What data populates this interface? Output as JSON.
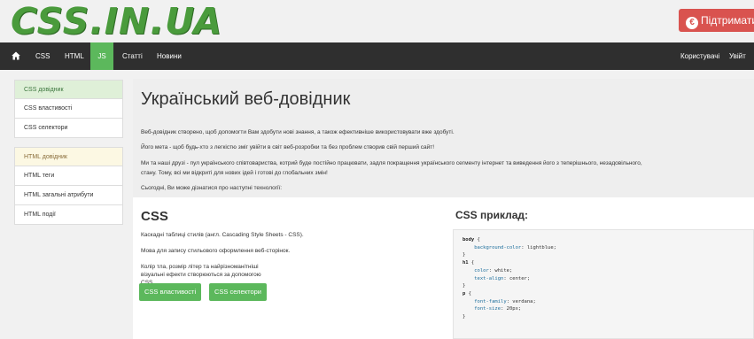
{
  "header": {
    "logo": "CSS.IN.UA",
    "support_label": "Підтримати",
    "support_icon": "euro-icon"
  },
  "nav": {
    "home_icon": "home-icon",
    "items": [
      "CSS",
      "HTML",
      "JS",
      "Статті",
      "Новини"
    ],
    "right": [
      "Користувачі",
      "Увійт"
    ],
    "active": "JS"
  },
  "sidebar": {
    "groups": [
      {
        "title": "CSS довідник",
        "items": [
          "CSS властивості",
          "CSS селектори"
        ]
      },
      {
        "title": "HTML довідник",
        "items": [
          "HTML теги",
          "HTML загальні атрибути",
          "HTML події"
        ]
      }
    ]
  },
  "main": {
    "title": "Український веб-довідник",
    "paragraphs": [
      "Веб-довідник створено, щоб допомогти Вам здобути нові знання, а також ефективніше використовувати вже здобуті.",
      "Його мета - щоб будь-хто з легкістю зміг увійти в світ веб-розробки та без проблем створив свій перший сайт!",
      "Ми та наші друзі - пул українського співтовариства, котрий буде постійно працювати, задля покращення українського сегменту інтернет та виведення його з теперішнього, незадовільного,",
      "стану. Тому, всі ми відкриті для нових ідей і готові до глобальних змін!",
      "Сьогодні, Ви може дізнатися про наступні технології:"
    ],
    "section_title": "CSS",
    "section_paragraphs": [
      "Каскадні таблиці стилів (англ. Cascading Style Sheets - CSS).",
      "Мова для запису стильового оформлення веб-сторінок.",
      "Колір тла, розмір літер та найрізноманітніші візуальні ефекти створюються за допомогою CSS."
    ],
    "buttons": [
      "CSS властивості",
      "CSS селектори"
    ],
    "example_title": "CSS приклад:",
    "code_lines": [
      [
        "body",
        " {"
      ],
      [
        "",
        "    background-color: lightblue;"
      ],
      [
        "",
        "}"
      ],
      [
        "h1",
        " {"
      ],
      [
        "",
        "    color: white;"
      ],
      [
        "",
        "    text-align: center;"
      ],
      [
        "",
        "}"
      ],
      [
        "p",
        " {"
      ],
      [
        "",
        "    font-family: verdana;"
      ],
      [
        "",
        "    font-size: 20px;"
      ],
      [
        "",
        "}"
      ]
    ]
  },
  "colors": {
    "brand_green": "#4a9b3c",
    "nav_bg": "#2f2f2f",
    "active_green": "#5cb85c",
    "danger_red": "#d9534f"
  }
}
